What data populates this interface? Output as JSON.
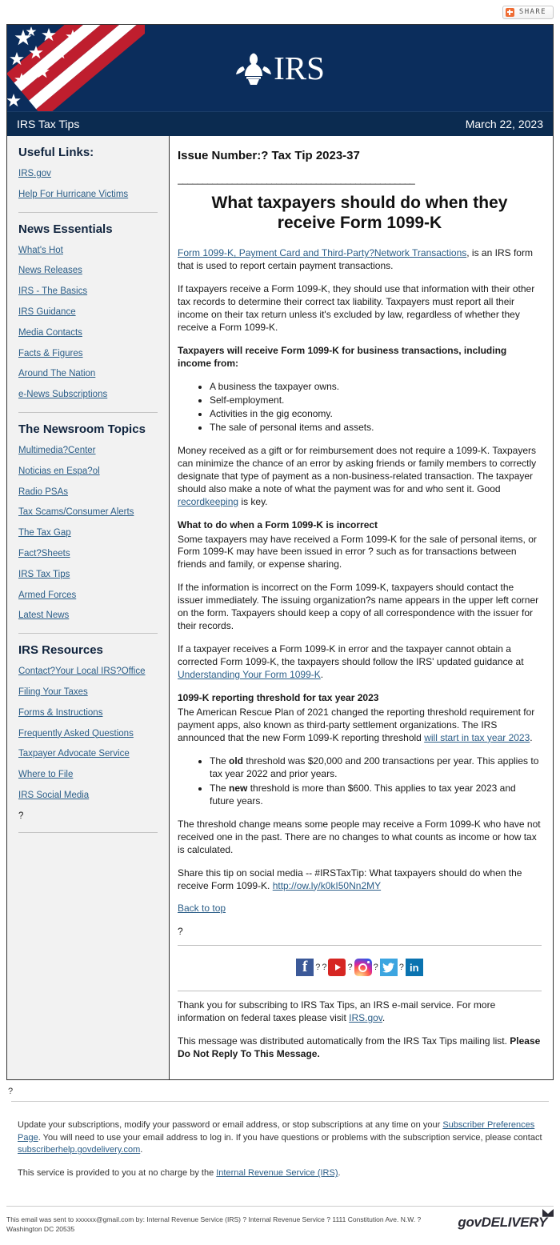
{
  "share": {
    "label": "SHARE",
    "icon": "plus-icon",
    "accent": "#ef6c33"
  },
  "masthead": {
    "logo_text": "IRS",
    "flag_alt": "us-flag",
    "bg_color": "#0b2d5c"
  },
  "titlebar": {
    "publication": "IRS Tax Tips",
    "date": "March 22, 2023"
  },
  "sidebar": {
    "sections": [
      {
        "heading": "Useful Links:",
        "links": [
          "IRS.gov",
          "Help For Hurricane Victims"
        ]
      },
      {
        "heading": "News Essentials",
        "links": [
          "What's Hot",
          "News Releases",
          "IRS - The Basics",
          "IRS Guidance",
          "Media Contacts",
          "Facts & Figures",
          "Around The Nation",
          "e-News Subscriptions"
        ]
      },
      {
        "heading": "The Newsroom Topics",
        "links": [
          "Multimedia?Center",
          "Noticias en Espa?ol",
          "Radio PSAs",
          "Tax Scams/Consumer Alerts",
          "The Tax Gap",
          "Fact?Sheets",
          "IRS Tax Tips",
          "Armed Forces",
          "Latest News"
        ]
      },
      {
        "heading": "IRS Resources",
        "links": [
          "Contact?Your Local IRS?Office",
          "Filing Your Taxes",
          "Forms & Instructions",
          "Frequently Asked Questions",
          "Taxpayer Advocate Service",
          "Where to File",
          "IRS Social Media"
        ],
        "trailing_char": "?"
      }
    ]
  },
  "article": {
    "issue_number": "Issue Number:? Tax Tip 2023-37",
    "divider": "________________________________________________",
    "headline": "What taxpayers should do when they receive Form 1099-K",
    "p1_link": "Form 1099-K, Payment Card and Third-Party?Network Transactions",
    "p1_rest": ", is an IRS form that is used to report certain payment transactions.",
    "p2": "If taxpayers receive a Form 1099-K, they should use that information with their other tax records to determine their correct tax liability. Taxpayers must report all their income on their tax return unless it's excluded by law, regardless of whether they receive a Form 1099-K.",
    "p3_bold": "Taxpayers will receive Form 1099-K for business transactions, including income from:",
    "list1": [
      "A business the taxpayer owns.",
      "Self-employment.",
      "Activities in the gig economy.",
      "The sale of personal items and assets."
    ],
    "p4_a": "Money received as a gift or for reimbursement does not require a 1099-K. Taxpayers can minimize the chance of an error by asking friends or family members to correctly designate that type of payment as a non-business-related transaction. The taxpayer should also make a note of what the payment was for and who sent it. Good ",
    "p4_link": "recordkeeping",
    "p4_b": " is key.",
    "h_incorrect": "What to do when a Form 1099-K is incorrect",
    "p5": "Some taxpayers may have received a Form 1099-K for the sale of personal items, or Form 1099-K may have been issued in error ? such as for transactions between friends and family, or expense sharing.",
    "p6": "If the information is incorrect on the Form 1099-K, taxpayers should contact the issuer immediately. The issuing organization?s name appears in the upper left corner on the form. Taxpayers should keep a copy of all correspondence with the issuer for their records.",
    "p7_a": "If a taxpayer receives a Form 1099-K in error and the taxpayer cannot obtain a corrected Form 1099-K, the taxpayers should follow the IRS' updated guidance at ",
    "p7_link": "Understanding Your Form 1099-K",
    "p7_b": ".",
    "h_threshold": "1099-K reporting threshold for tax year 2023",
    "p8_a": "The American Rescue Plan of 2021 changed the reporting threshold requirement for payment apps, also known as third-party settlement organizations. The IRS announced that the new Form 1099-K reporting threshold ",
    "p8_link": "will start in tax year 2023",
    "p8_b": ".",
    "list2": [
      {
        "pre": "The ",
        "bold": "old",
        "post": " threshold was $20,000 and 200 transactions per year. This applies to tax year 2022 and prior years."
      },
      {
        "pre": "The ",
        "bold": "new",
        "post": " threshold is more than $600. This applies to tax year 2023 and future years."
      }
    ],
    "p9": "The threshold change means some people may receive a Form 1099-K who have not received one in the past. There are no changes to what counts as income or how tax is calculated.",
    "p10_text": "Share this tip on social media -- #IRSTaxTip: What taxpayers should do when the receive Form 1099-K. ",
    "p10_link": "http://ow.ly/k0kI50Nn2MY",
    "back_to_top": "Back to top",
    "trailing_char": "?"
  },
  "social": {
    "separator": "?",
    "items": [
      {
        "name": "facebook-icon",
        "glyph": "f"
      },
      {
        "name": "youtube-icon",
        "glyph": ""
      },
      {
        "name": "instagram-icon",
        "glyph": ""
      },
      {
        "name": "twitter-icon",
        "glyph": ""
      },
      {
        "name": "linkedin-icon",
        "glyph": "in"
      }
    ]
  },
  "closing": {
    "thanks_a": "Thank you for subscribing to IRS Tax Tips, an IRS e-mail service. For more information on federal taxes please visit ",
    "thanks_link": "IRS.gov",
    "thanks_b": ".",
    "auto_a": "This message was distributed automatically from the IRS Tax Tips mailing list. ",
    "auto_bold": "Please Do Not Reply To This Message."
  },
  "outside": {
    "stray_char": "?"
  },
  "subfooter": {
    "p1_a": "Update your subscriptions, modify your password or email address, or stop subscriptions at any time on your ",
    "p1_link": "Subscriber Preferences Page",
    "p1_b": ". You will need to use your email address to log in. If you have questions or problems with the subscription service, please contact ",
    "p1_link2": "subscriberhelp.govdelivery.com",
    "p1_c": ".",
    "p2_a": "This service is provided to you at no charge by the ",
    "p2_link": "Internal Revenue Service (IRS)",
    "p2_b": "."
  },
  "bottombar": {
    "sent_to": "This email was sent to xxxxxx@gmail.com by: Internal Revenue Service (IRS) ? Internal Revenue Service ? 1111 Constitution Ave. N.W. ? Washington DC 20535",
    "brand": "govDELIVERY"
  }
}
